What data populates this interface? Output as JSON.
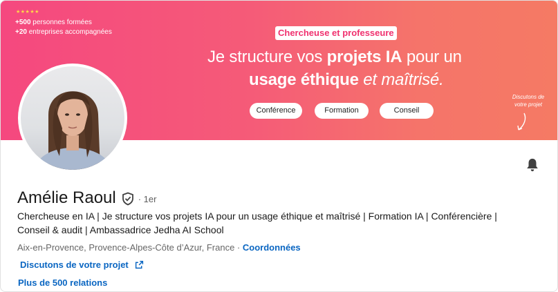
{
  "banner": {
    "rating_stars": "★★★★★",
    "stats": [
      {
        "bold": "+500",
        "text": " personnes formées"
      },
      {
        "bold": "+20",
        "text": " entreprises accompagnées"
      }
    ],
    "role_label": "Chercheuse et professeure",
    "headline_part1": "Je structure vos ",
    "headline_bold1": "projets IA",
    "headline_part2": " pour un",
    "headline_bold2": "usage éthique",
    "headline_italic": " et maîtrisé.",
    "chips": [
      "Conférence",
      "Formation",
      "Conseil"
    ],
    "discuss_note_line1": "Discutons de",
    "discuss_note_line2": "votre projet",
    "colors": {
      "gradient_start": "#f5487f",
      "gradient_end": "#f57a64",
      "role_text": "#f0306e"
    }
  },
  "profile": {
    "name": "Amélie Raoul",
    "degree": "· 1er",
    "headline": "Chercheuse en IA | Je structure vos projets IA pour un usage éthique et maîtrisé | Formation IA | Conférencière | Conseil & audit | Ambassadrice Jedha AI School",
    "location": "Aix-en-Provence, Provence-Alpes-Côte d’Azur, France",
    "location_sep": " · ",
    "contact_link": "Coordonnées",
    "cta_label": "Discutons de votre projet",
    "relations": "Plus de 500 relations",
    "link_color": "#0a66c2"
  },
  "icons": {
    "verified": "shield-check-icon",
    "bell": "bell-icon",
    "external": "external-link-icon"
  }
}
